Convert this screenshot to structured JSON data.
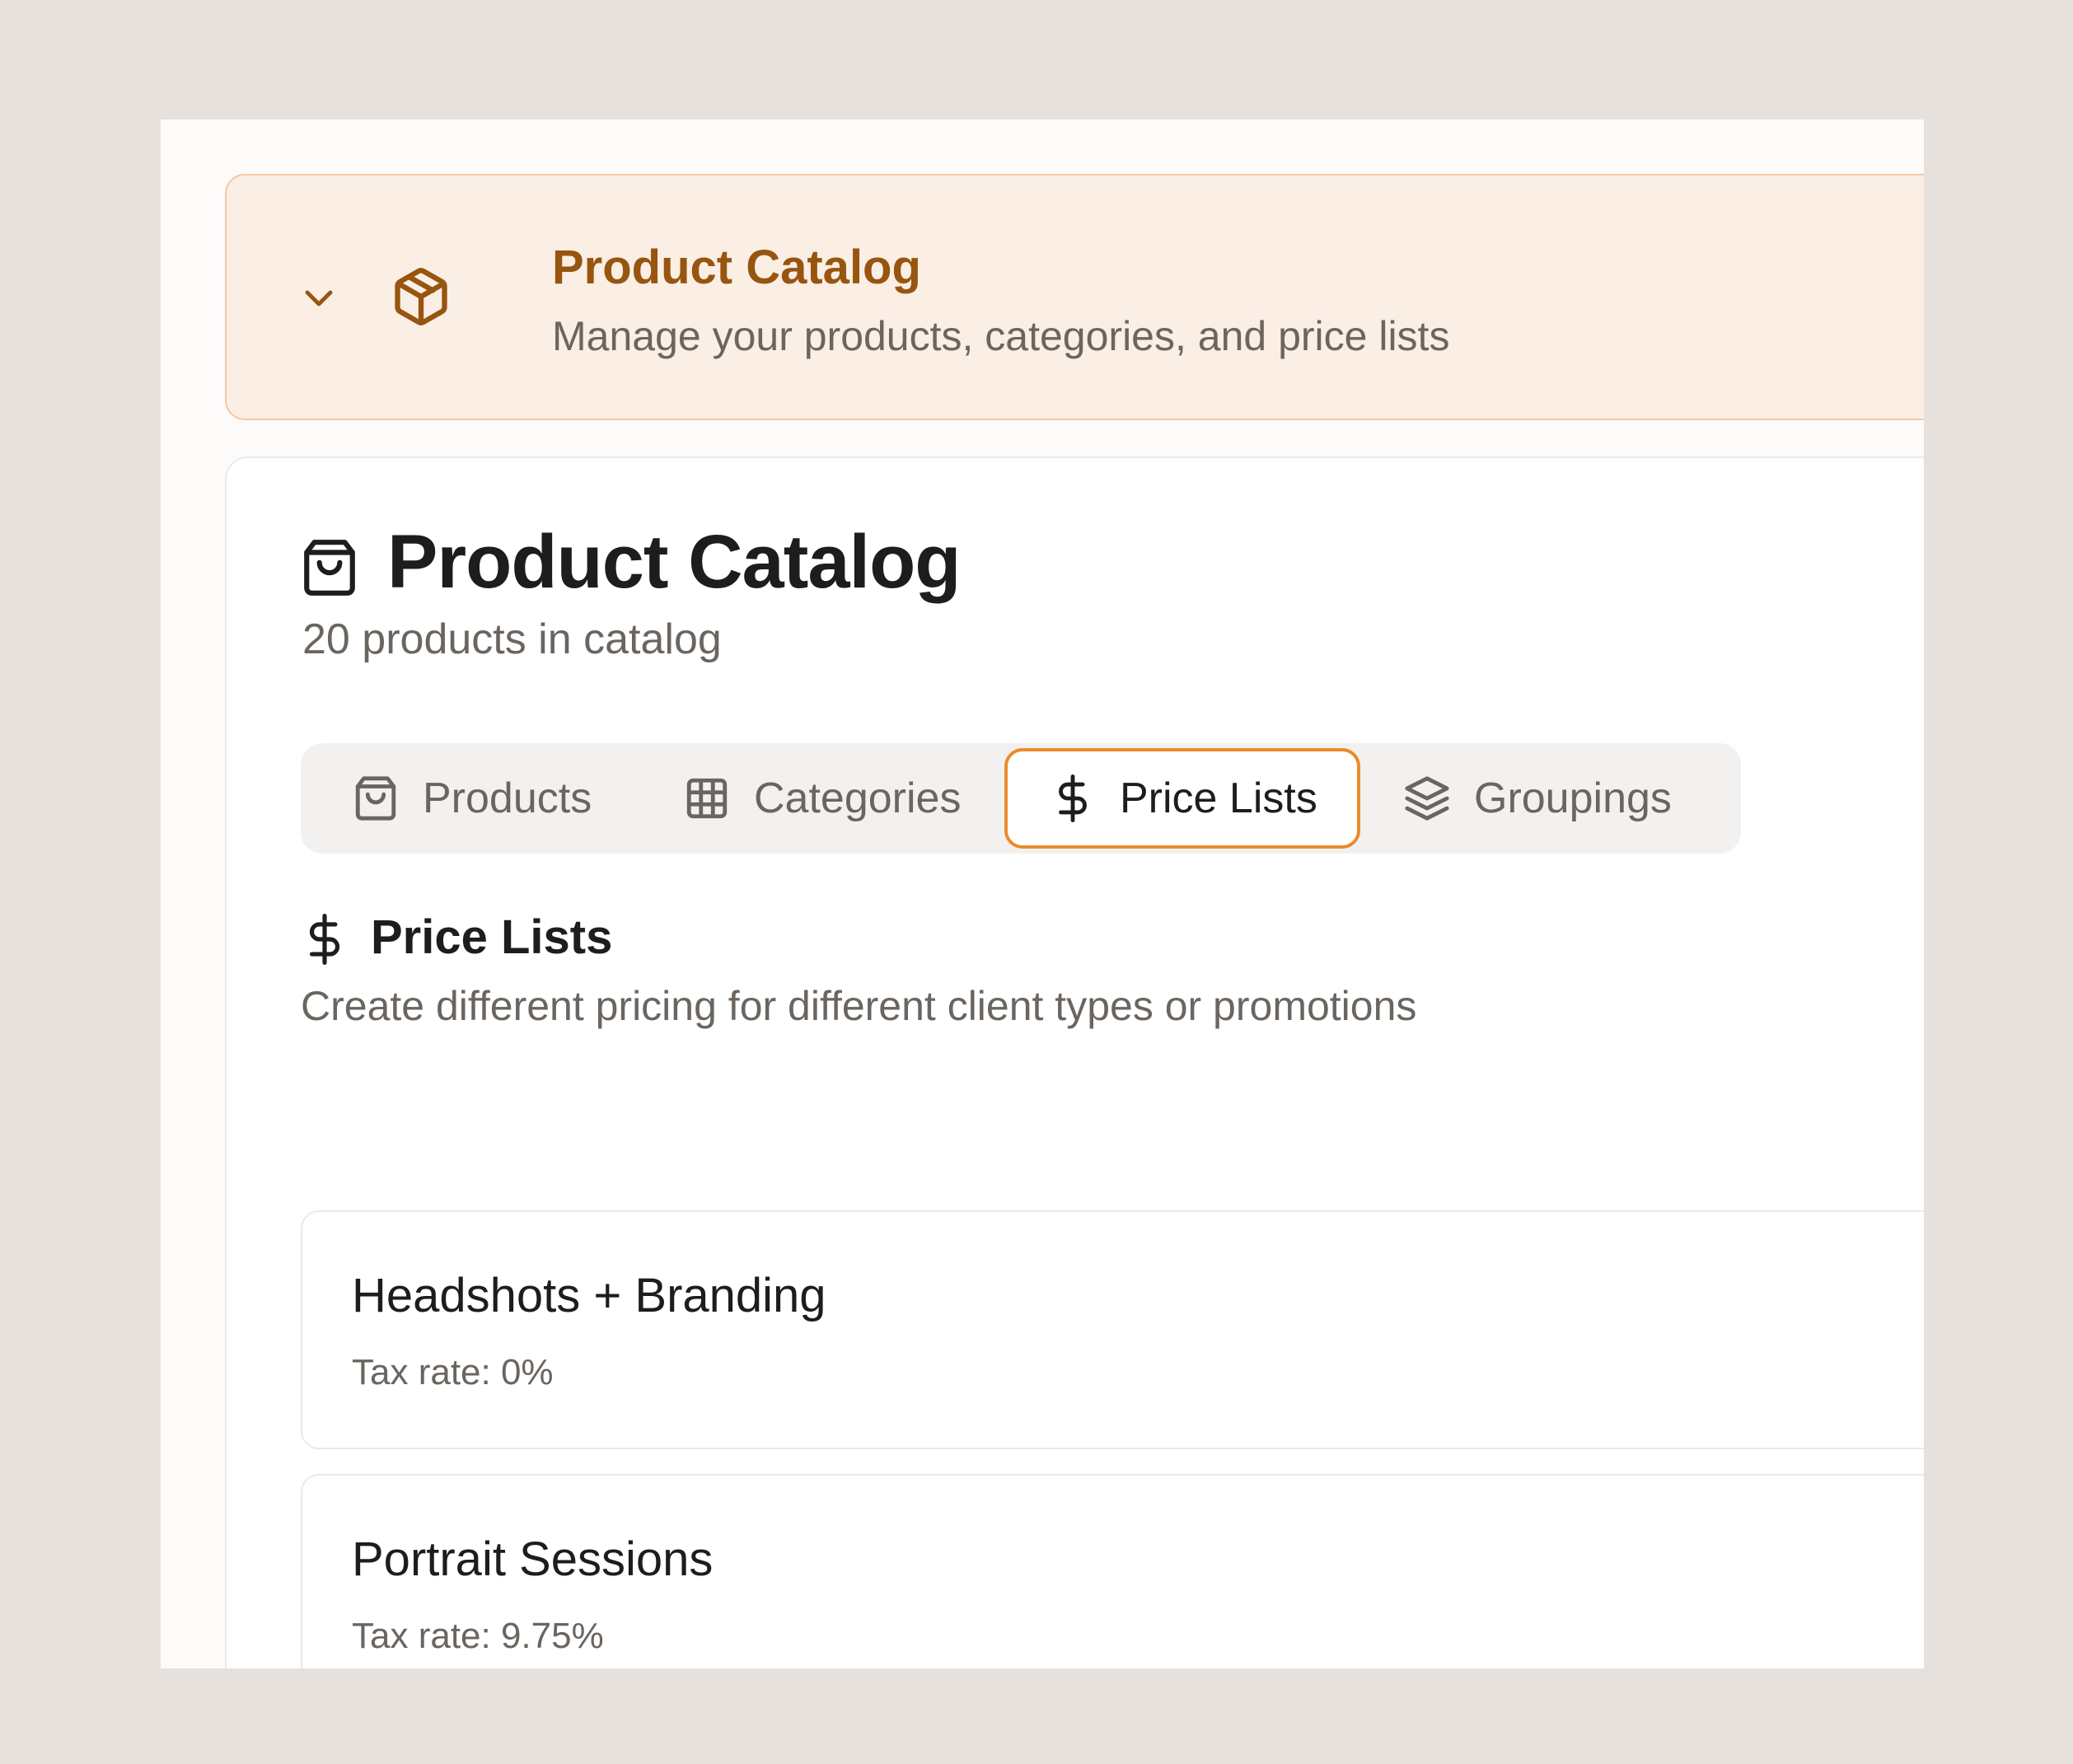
{
  "banner": {
    "title": "Product Catalog",
    "subtitle": "Manage your products, categories, and price lists",
    "expand_icon": "chevron-down-icon",
    "icon": "package-icon"
  },
  "header": {
    "icon": "shopping-bag-icon",
    "title": "Product Catalog",
    "subtitle": "20 products in catalog"
  },
  "tabs": [
    {
      "label": "Products",
      "icon": "shopping-bag-icon",
      "active": false
    },
    {
      "label": "Categories",
      "icon": "grid-icon",
      "active": false
    },
    {
      "label": "Price Lists",
      "icon": "dollar-icon",
      "active": true
    },
    {
      "label": "Groupings",
      "icon": "layers-icon",
      "active": false
    }
  ],
  "section": {
    "icon": "dollar-icon",
    "title": "Price Lists",
    "subtitle": "Create different pricing for different client types or promotions"
  },
  "price_lists": [
    {
      "name": "Headshots + Branding",
      "tax": "Tax rate: 0%"
    },
    {
      "name": "Portrait Sessions",
      "tax": "Tax rate: 9.75%"
    }
  ],
  "colors": {
    "accent": "#ec8a2c",
    "banner_title": "#97550f",
    "banner_bg": "#faeee5",
    "page_bg": "#e6e1dc"
  }
}
